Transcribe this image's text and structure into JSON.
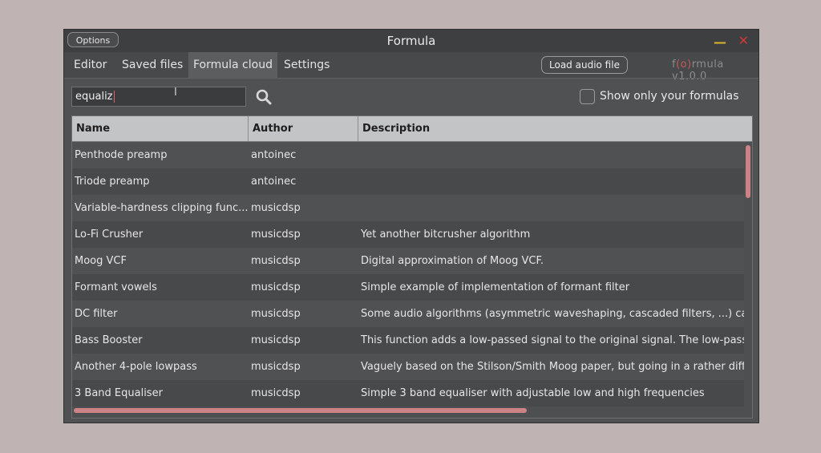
{
  "window": {
    "title": "Formula",
    "options_label": "Options",
    "minimize_glyph": "—",
    "close_glyph": "✕"
  },
  "tabs": [
    {
      "label": "Editor",
      "active": false
    },
    {
      "label": "Saved files",
      "active": false
    },
    {
      "label": "Formula cloud",
      "active": true
    },
    {
      "label": "Settings",
      "active": false
    }
  ],
  "toolbar": {
    "load_audio_label": "Load audio file",
    "brand_prefix": "f",
    "brand_accent": "(o)",
    "brand_suffix": "rmula v1.0.0"
  },
  "search": {
    "value": "equaliz",
    "icon": "search-icon"
  },
  "filter": {
    "label": "Show only your formulas",
    "checked": false
  },
  "table": {
    "columns": [
      "Name",
      "Author",
      "Description"
    ],
    "rows": [
      {
        "name": "Penthode preamp",
        "author": "antoinec",
        "description": ""
      },
      {
        "name": "Triode preamp",
        "author": "antoinec",
        "description": ""
      },
      {
        "name": "Variable-hardness clipping func...",
        "author": "musicdsp",
        "description": ""
      },
      {
        "name": "Lo-Fi Crusher",
        "author": "musicdsp",
        "description": "Yet another bitcrusher algorithm"
      },
      {
        "name": "Moog VCF",
        "author": "musicdsp",
        "description": "Digital approximation of Moog VCF."
      },
      {
        "name": "Formant vowels",
        "author": "musicdsp",
        "description": "Simple example of implementation of formant filter"
      },
      {
        "name": "DC filter",
        "author": "musicdsp",
        "description": "Some audio algorithms (asymmetric waveshaping, cascaded filters, ...) car"
      },
      {
        "name": "Bass Booster",
        "author": "musicdsp",
        "description": "This function adds a low-passed signal to the original signal. The low-pass f"
      },
      {
        "name": "Another 4-pole lowpass",
        "author": "musicdsp",
        "description": "Vaguely based on the Stilson/Smith Moog paper, but going in a rather diffe"
      },
      {
        "name": "3 Band Equaliser",
        "author": "musicdsp",
        "description": "Simple 3 band equaliser with adjustable low and high frequencies"
      }
    ]
  },
  "colors": {
    "accent": "#cd8385",
    "minimize": "#d8b42e",
    "close": "#d13a3a"
  }
}
